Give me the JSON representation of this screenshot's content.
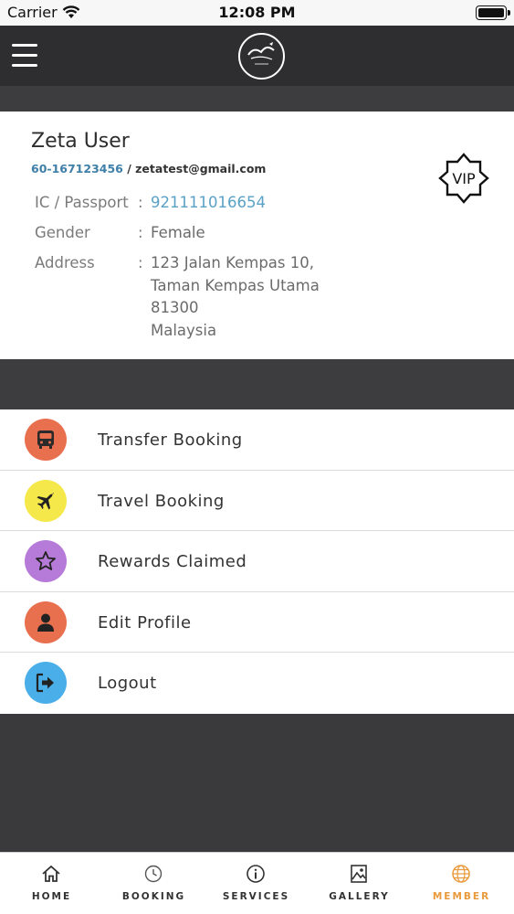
{
  "status_bar": {
    "carrier": "Carrier",
    "time": "12:08 PM"
  },
  "header": {
    "menu_icon": "hamburger-icon",
    "logo_icon": "brand-logo-icon"
  },
  "profile": {
    "name": "Zeta User",
    "phone": "60-167123456",
    "separator": " / ",
    "email": "zetatest@gmail.com",
    "badge": "VIP",
    "fields": {
      "ic_label": "IC / Passport",
      "ic_value": "921111016654",
      "gender_label": "Gender",
      "gender_value": "Female",
      "address_label": "Address",
      "address_line1": "123 Jalan Kempas 10,",
      "address_line2": "Taman Kempas Utama",
      "address_line3": "81300",
      "address_line4": "Malaysia",
      "colon": ":"
    }
  },
  "menu": {
    "items": [
      {
        "label": "Transfer Booking",
        "icon": "bus-icon",
        "color": "#e8704f"
      },
      {
        "label": "Travel Booking",
        "icon": "airplane-icon",
        "color": "#f5e84a"
      },
      {
        "label": "Rewards Claimed",
        "icon": "star-icon",
        "color": "#b67ad8"
      },
      {
        "label": "Edit Profile",
        "icon": "user-icon",
        "color": "#e8704f"
      },
      {
        "label": "Logout",
        "icon": "logout-icon",
        "color": "#4aaee8"
      }
    ]
  },
  "tabs": [
    {
      "label": "HOME",
      "icon": "home-icon"
    },
    {
      "label": "BOOKING",
      "icon": "clock-icon"
    },
    {
      "label": "SERVICES",
      "icon": "info-icon"
    },
    {
      "label": "GALLERY",
      "icon": "gallery-icon"
    },
    {
      "label": "MEMBER",
      "icon": "globe-icon",
      "active": true
    }
  ],
  "colors": {
    "accent": "#e89a3c",
    "link": "#3f7fa8",
    "header": "#2e2d2f",
    "background": "#3a393b"
  }
}
